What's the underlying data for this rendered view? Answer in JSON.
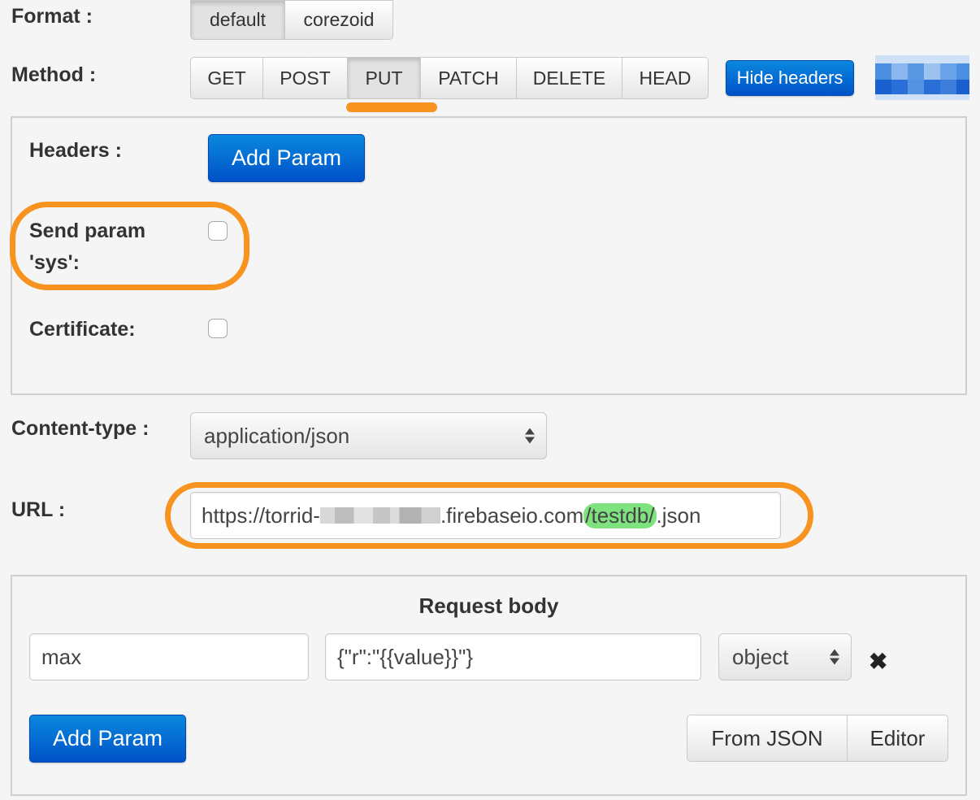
{
  "format": {
    "label": "Format :",
    "options": [
      "default",
      "corezoid"
    ],
    "selected": "default"
  },
  "method": {
    "label": "Method :",
    "options": [
      "GET",
      "POST",
      "PUT",
      "PATCH",
      "DELETE",
      "HEAD"
    ],
    "selected": "PUT",
    "hide_headers_label": "Hide headers"
  },
  "headers": {
    "label": "Headers :",
    "add_param_label": "Add Param",
    "send_param_sys_label_line1": "Send param",
    "send_param_sys_label_line2": "'sys':",
    "send_param_sys_checked": false,
    "certificate_label": "Certificate:",
    "certificate_checked": false
  },
  "content_type": {
    "label": "Content-type :",
    "value": "application/json"
  },
  "url": {
    "label": "URL :",
    "prefix": "https://torrid-",
    "middle": ".firebaseio.com",
    "highlighted": "/testdb/",
    "suffix": ".json"
  },
  "request_body": {
    "title": "Request body",
    "param_name": "max",
    "param_value": "{\"r\":\"{{value}}\"}",
    "param_type": "object",
    "add_param_label": "Add Param",
    "from_json_label": "From JSON",
    "editor_label": "Editor"
  },
  "colors": {
    "accent_orange": "#f7931e",
    "primary_blue": "#0052c8",
    "highlight_green": "#7ee37e"
  }
}
